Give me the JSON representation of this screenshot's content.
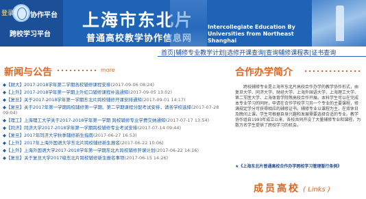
{
  "header": {
    "login": "登录",
    "platform": "协作平台",
    "portal": "跨校学习平台",
    "title": "上海市东北片",
    "subtitle": "普通高校教学协作信息网",
    "english": "Intercollegiate Education By Universities from Northeast Shanghai"
  },
  "nav": {
    "items": [
      "首页",
      "辅修专业教学计划",
      "选修开课查询",
      "查询辅修课程表",
      "证书查询"
    ]
  },
  "news": {
    "title": "新闻与公告",
    "more": "more",
    "items": [
      {
        "cat": "【财大】",
        "title": "2017-2018学年第二学期各校辅修课程安排",
        "date": "(2017-09-06 08:24)"
      },
      {
        "cat": "【上外】",
        "title": "2017-2018学年第一学期上外虹口辅修课程补选通知",
        "date": "(2017-09-05 13:02)"
      },
      {
        "cat": "【复旦】",
        "title": "关于2017-2018学年第一学期东北片跨校辅修开课安排通知",
        "date": "(2017-09-01 14:17)"
      },
      {
        "cat": "【复旦】",
        "title": "关于2017年第一学期跨校辅修第一学期、第二学期课程分配考试安排，请各学校选择",
        "date": "(2017-07-28 09:04)"
      },
      {
        "cat": "【理工】",
        "title": "上海理工大学关于2017-2018学年第一学期 跨校辅修专业学费交纳通知",
        "date": "(2017-07-17 13:54)"
      },
      {
        "cat": "【同济】",
        "title": "同济大学2017-2018学年第一学期跨校辅修专业考试安排",
        "date": "(2017-07-14 09:44)"
      },
      {
        "cat": "【复旦】",
        "title": "2017年同济大学秋季辅修新生指南",
        "date": "(2017-06-27 16:53)"
      },
      {
        "cat": "【上外】",
        "title": "2017年上海外国语大学东北片跨校辅修新生报名",
        "date": "(2017-06-22 10:06)"
      },
      {
        "cat": "【上外】",
        "title": "上海外国语大学2017-2018学年第一学期东北片跨校辅修开课计划",
        "date": "(2017-06-22 14:16)"
      },
      {
        "cat": "【复旦】",
        "title": "关于复旦大学2017级东北片跨校辅修新生报名事项",
        "date": "(2017-06-15 14:26)"
      }
    ]
  },
  "coop": {
    "title": "合作办学简介",
    "body": "跨校辅修专业是上海市东北片高校合作办学的教学协作形式，由复旦大学、同济大学、财经大学、上海外国语大学、上海理工大学、第二军医大学、上海体育学院等高校合作开展。本科学生可以在完成本专业学习的同时，申请在合作学校学习另一个专业的主要课程，修满规定学分可获得相应的辅修证书。辅修专业以课程为主，在双休日及晚间上课，学生可根据自身兴趣和发展需要选择合适的专业。教学协作组自1993年成立以来，各校共同开设了大量辅修专业和课程，为数万名学生提供了跨校学习的机会。",
    "link": "《上海东北片普通高校合作办学跨校学习管理暂行条例》"
  },
  "members": {
    "title": "成员高校",
    "en": "( Links )"
  }
}
